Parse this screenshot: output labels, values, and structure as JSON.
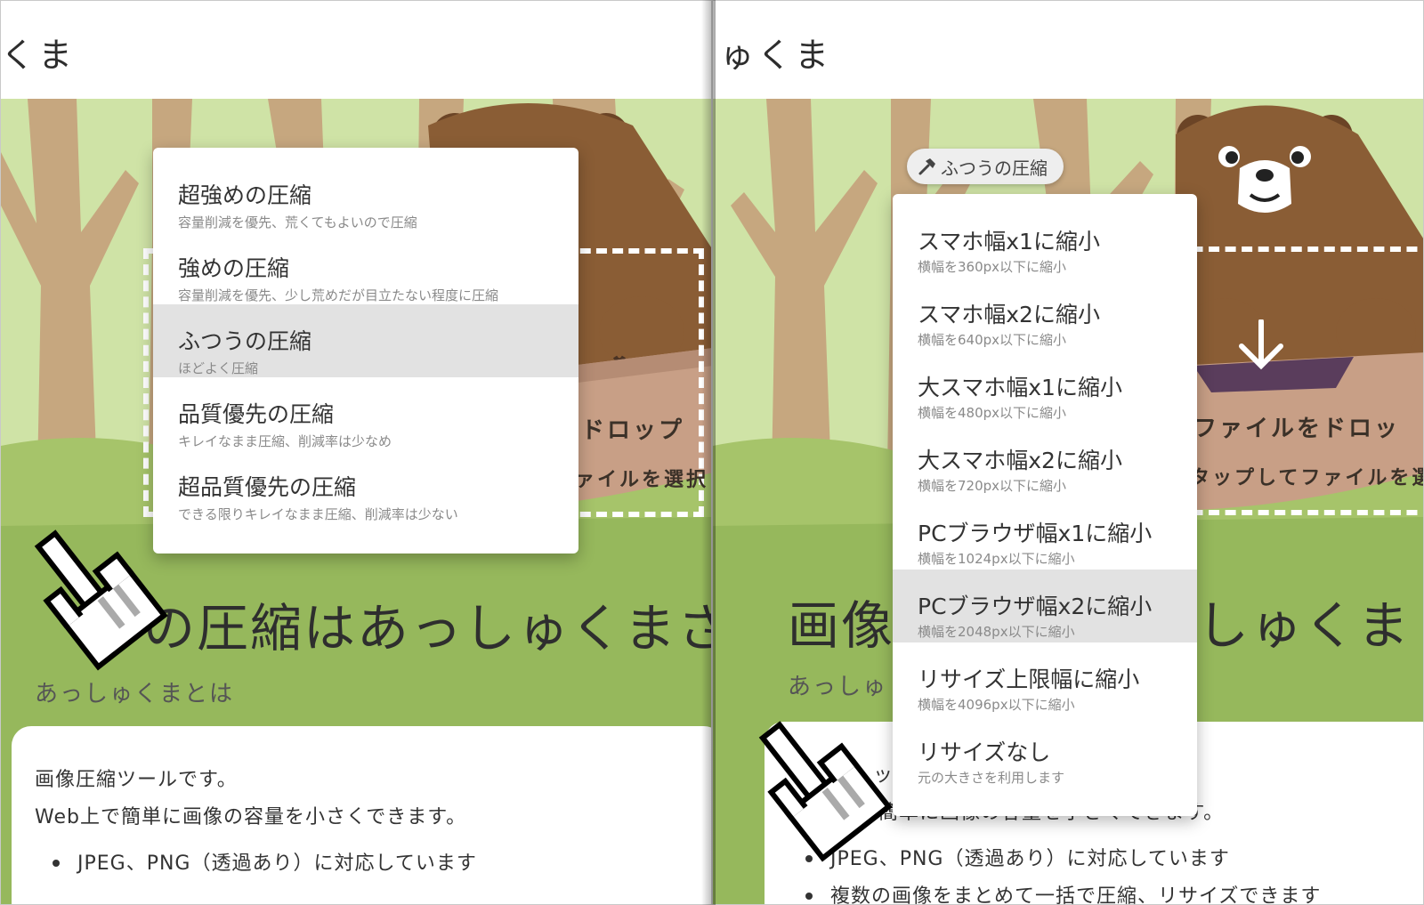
{
  "logo": {
    "left_text": "くま",
    "right_text": "ゅくま"
  },
  "left": {
    "drop_text_1": "ドロップ",
    "drop_text_2": "ァイルを選択",
    "title": "の圧縮はあっしゅくまさ",
    "subtitle": "あっしゅくまとは",
    "card": {
      "line1": "画像圧縮ツールです。",
      "line2": "Web上で簡単に画像の容量を小さくできます。",
      "bullet1": "JPEG、PNG（透過あり）に対応しています"
    },
    "menu": [
      {
        "title": "超強めの圧縮",
        "desc": "容量削減を優先、荒くてもよいので圧縮",
        "selected": false
      },
      {
        "title": "強めの圧縮",
        "desc": "容量削減を優先、少し荒めだが目立たない程度に圧縮",
        "selected": false
      },
      {
        "title": "ふつうの圧縮",
        "desc": "ほどよく圧縮",
        "selected": true
      },
      {
        "title": "品質優先の圧縮",
        "desc": "キレイなまま圧縮、削減率は少なめ",
        "selected": false
      },
      {
        "title": "超品質優先の圧縮",
        "desc": "できる限りキレイなまま圧縮、削減率は少ない",
        "selected": false
      }
    ]
  },
  "right": {
    "chip_label": "ふつうの圧縮",
    "chip_icon": "hammer-icon",
    "drop_text_1": "ファイルをドロッ",
    "drop_text_2": "タップしてファイルを選",
    "title_a": "画像",
    "title_b": "しゅくま",
    "subtitle": "あっしゅ",
    "card": {
      "fragment": "ッ",
      "line2": "簡単に画像の容量を小さくできます。",
      "bullet1": "JPEG、PNG（透過あり）に対応しています",
      "bullet2": "複数の画像をまとめて一括で圧縮、リサイズできます"
    },
    "menu": [
      {
        "title": "スマホ幅x1に縮小",
        "desc": "横幅を360px以下に縮小",
        "selected": false
      },
      {
        "title": "スマホ幅x2に縮小",
        "desc": "横幅を640px以下に縮小",
        "selected": false
      },
      {
        "title": "大スマホ幅x1に縮小",
        "desc": "横幅を480px以下に縮小",
        "selected": false
      },
      {
        "title": "大スマホ幅x2に縮小",
        "desc": "横幅を720px以下に縮小",
        "selected": false
      },
      {
        "title": "PCブラウザ幅x1に縮小",
        "desc": "横幅を1024px以下に縮小",
        "selected": false
      },
      {
        "title": "PCブラウザ幅x2に縮小",
        "desc": "横幅を2048px以下に縮小",
        "selected": true
      },
      {
        "title": "リサイズ上限幅に縮小",
        "desc": "横幅を4096px以下に縮小",
        "selected": false
      },
      {
        "title": "リサイズなし",
        "desc": "元の大きさを利用します",
        "selected": false
      }
    ]
  },
  "colors": {
    "sky": "#cfe3a6",
    "grass": "#96b85c",
    "trunk": "#c6a77f",
    "bear": "#8a5d35",
    "box": "#c89f86",
    "selected_row": "#e2e2e2"
  }
}
